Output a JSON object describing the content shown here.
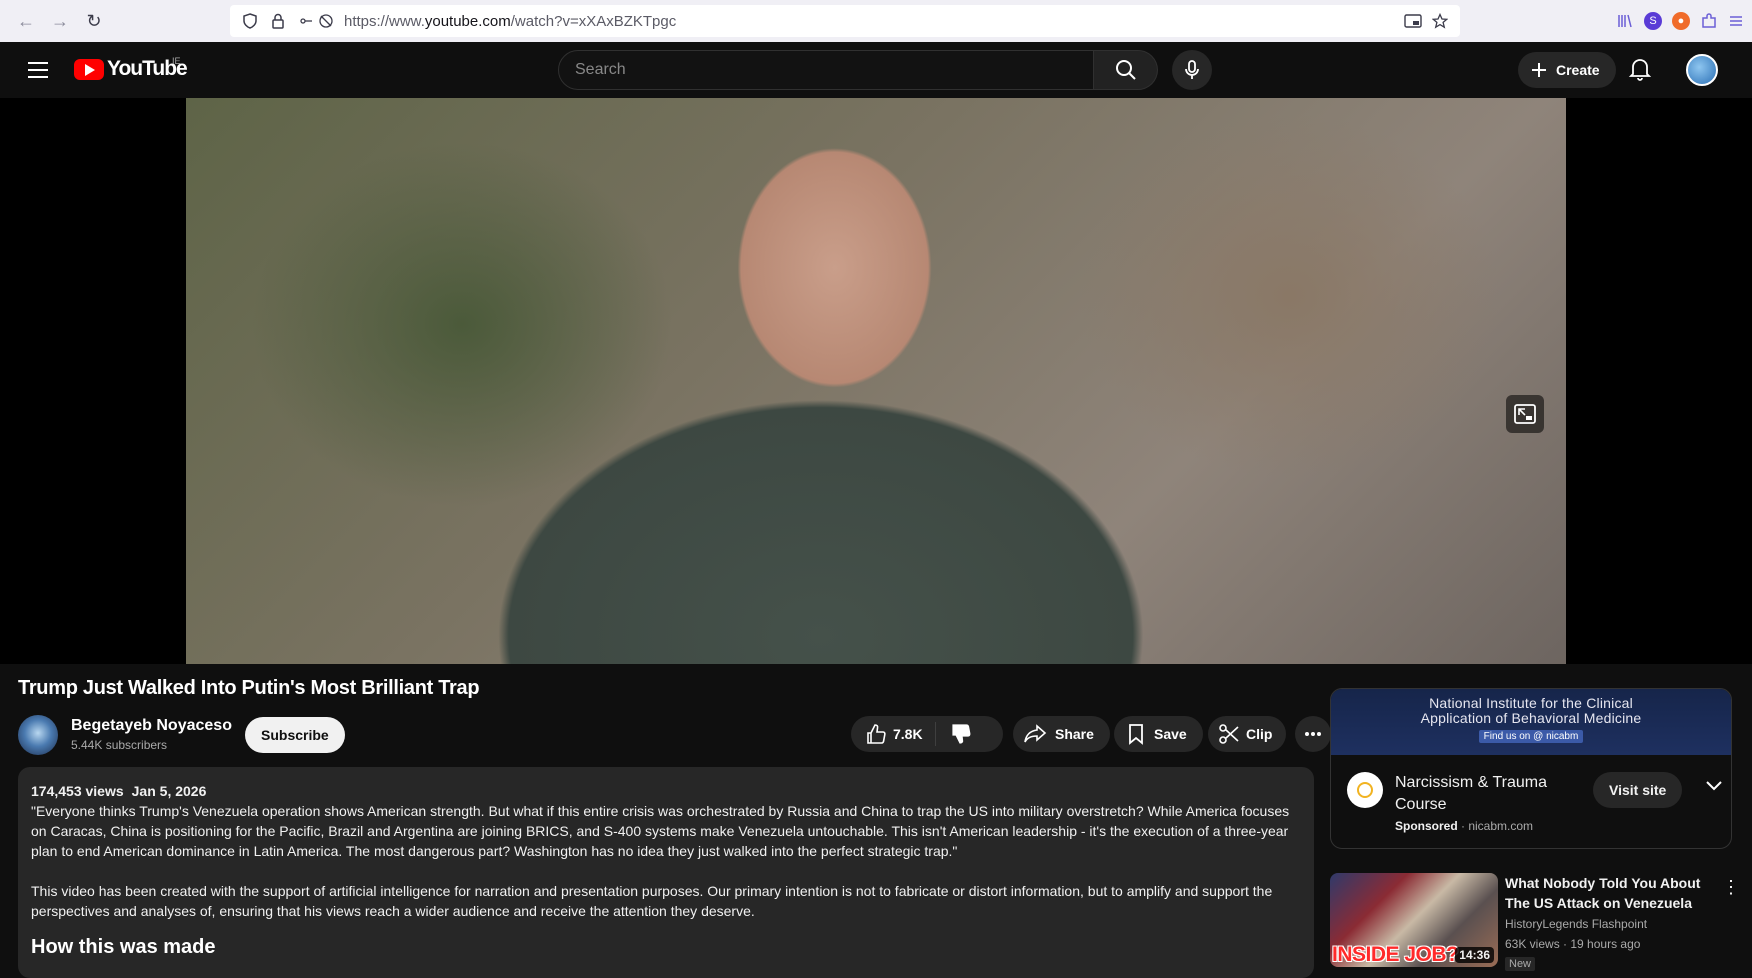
{
  "browser": {
    "url_prefix": "https://www.",
    "url_domain": "youtube.com",
    "url_path": "/watch?v=xXAxBZKTpgc"
  },
  "header": {
    "logo_text": "YouTube",
    "country": "IE",
    "search_placeholder": "Search",
    "create_label": "Create"
  },
  "video": {
    "title": "Trump Just Walked Into Putin's Most Brilliant Trap"
  },
  "channel": {
    "name": "Begetayeb Noyaceso",
    "subscribers": "5.44K subscribers",
    "subscribe_label": "Subscribe"
  },
  "actions": {
    "likes": "7.8K",
    "share": "Share",
    "save": "Save",
    "clip": "Clip"
  },
  "description": {
    "views": "174,453 views",
    "date": "Jan 5, 2026",
    "paragraph1": "\"Everyone thinks Trump's Venezuela operation shows American strength. But what if this entire crisis was orchestrated by Russia and China to trap the US into military overstretch? While America focuses on Caracas, China is positioning for the Pacific, Brazil and Argentina are joining BRICS, and S-400 systems make Venezuela untouchable. This isn't American leadership - it's the execution of a three-year plan to end American dominance in Latin America. The most dangerous part? Washington has no idea they just walked into the perfect strategic trap.\"",
    "paragraph2": "This video has been created with the support of artificial intelligence for narration and presentation purposes. Our primary intention is not to fabricate or distort information, but to amplify and support the perspectives and analyses of, ensuring that his views reach a wider audience and receive the attention they deserve.",
    "heading": "How this was made"
  },
  "ad": {
    "banner_line1": "National Institute for the Clinical",
    "banner_line2": "Application of Behavioral Medicine",
    "banner_find": "Find us on  @ nicabm",
    "name": "Narcissism & Trauma Course",
    "sponsored": "Sponsored",
    "domain": "nicabm.com",
    "visit_label": "Visit site"
  },
  "recommendation": {
    "title": "What Nobody Told You About The US Attack on Venezuela",
    "channel": "HistoryLegends Flashpoint",
    "views": "63K views",
    "age": "19 hours ago",
    "badge": "New",
    "duration": "14:36",
    "thumb_text": "INSIDE JOB?"
  }
}
